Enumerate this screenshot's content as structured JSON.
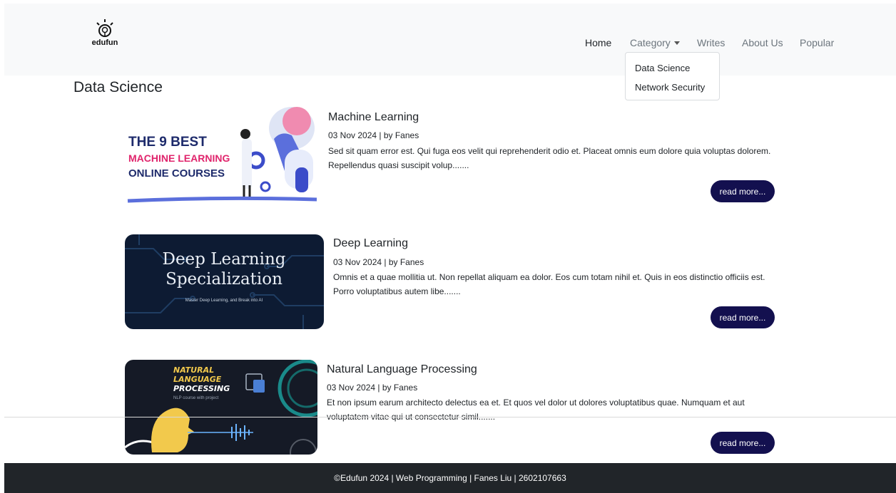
{
  "brand": {
    "name": "edufun",
    "icon": "lightbulb-icon"
  },
  "nav": {
    "home": "Home",
    "category": "Category",
    "writes": "Writes",
    "about": "About Us",
    "popular": "Popular"
  },
  "dropdown": {
    "items": [
      "Data Science",
      "Network Security"
    ]
  },
  "page_title": "Data Science",
  "articles": [
    {
      "title": "Machine Learning",
      "meta": "03 Nov 2024 | by Fanes",
      "description": "Sed sit quam error est. Qui fuga eos velit qui reprehenderit odio et. Placeat omnis eum dolore quia voluptas dolorem. Repellendus quasi suscipit volup.......",
      "button": "read more...",
      "image_text": [
        "THE 9 BEST",
        "MACHINE LEARNING",
        "ONLINE COURSES"
      ]
    },
    {
      "title": "Deep Learning",
      "meta": "03 Nov 2024 | by Fanes",
      "description": "Omnis et a quae mollitia ut. Non repellat aliquam ea dolor. Eos cum totam nihil et. Quis in eos distinctio officiis est. Porro voluptatibus autem libe.......",
      "button": "read more...",
      "image_text": [
        "Deep Learning",
        "Specialization",
        "Master Deep Learning, and Break into AI"
      ]
    },
    {
      "title": "Natural Language Processing",
      "meta": "03 Nov 2024 | by Fanes",
      "description": "Et non ipsum earum architecto delectus ea et. Et quos vel dolor ut dolores voluptatibus quae. Numquam et aut voluptatem vitae qui ut consectetur simil.......",
      "button": "read more...",
      "image_text": [
        "NATURAL",
        "LANGUAGE",
        "PROCESSING",
        "NLP course with project"
      ]
    }
  ],
  "footer": "©Edufun 2024 | Web Programming | Fanes Liu | 2602107663",
  "colors": {
    "button": "#13104f",
    "footer": "#212529",
    "navbar": "#f8f9fa"
  }
}
